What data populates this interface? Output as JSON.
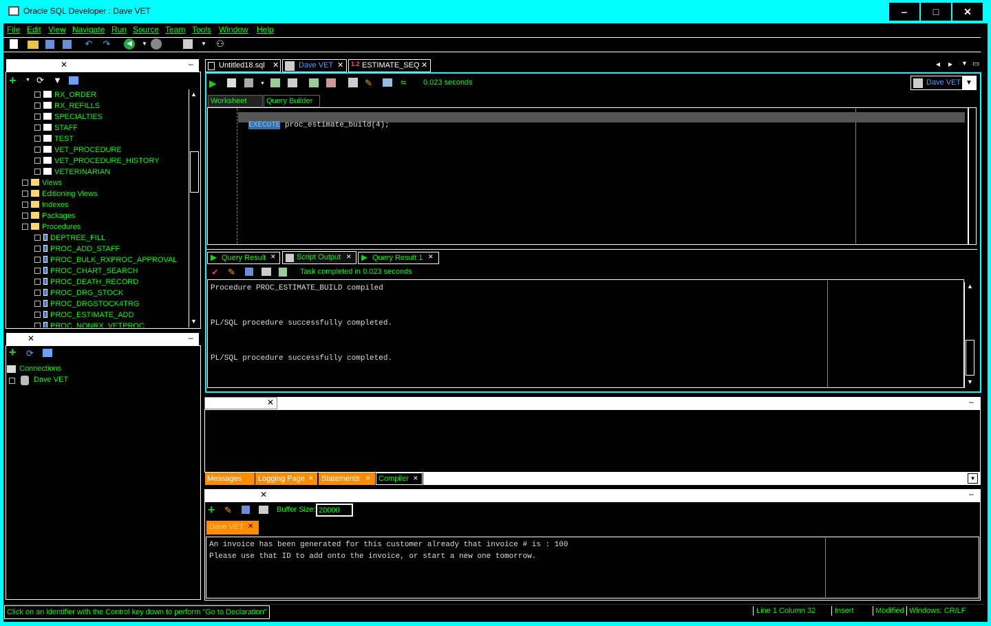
{
  "window": {
    "title": "Oracle SQL Developer : Dave VET",
    "min": "‒",
    "max": "□",
    "close": "✕"
  },
  "menu": [
    "File",
    "Edit",
    "View",
    "Navigate",
    "Run",
    "Source",
    "Team",
    "Tools",
    "Window",
    "Help"
  ],
  "editor_tabs": [
    {
      "label": "Untitled18.sql"
    },
    {
      "label": "Dave VET"
    },
    {
      "label": "ESTIMATE_SEQ"
    }
  ],
  "editor_toolbar": {
    "timing": "0.023 seconds",
    "connection": "Dave VET"
  },
  "subtabs": {
    "worksheet": "Worksheet",
    "query_builder": "Query Builder"
  },
  "code": {
    "keyword": "EXECUTE",
    "rest": " proc_estimate_build(4);"
  },
  "results_tabs": [
    "Query Result",
    "Script Output",
    "Query Result 1"
  ],
  "results_status": "Task completed in 0.023 seconds",
  "script_output": [
    "Procedure PROC_ESTIMATE_BUILD compiled",
    "",
    "",
    "PL/SQL procedure successfully completed.",
    "",
    "",
    "PL/SQL procedure successfully completed."
  ],
  "tree": [
    {
      "label": "RX_ORDER",
      "type": "table"
    },
    {
      "label": "RX_REFILLS",
      "type": "table"
    },
    {
      "label": "SPECIALTIES",
      "type": "table"
    },
    {
      "label": "STAFF",
      "type": "table"
    },
    {
      "label": "TEST",
      "type": "table"
    },
    {
      "label": "VET_PROCEDURE",
      "type": "table"
    },
    {
      "label": "VET_PROCEDURE_HISTORY",
      "type": "table"
    },
    {
      "label": "VETERINARIAN",
      "type": "table"
    },
    {
      "label": "Views",
      "type": "folder"
    },
    {
      "label": "Editioning Views",
      "type": "folder"
    },
    {
      "label": "Indexes",
      "type": "folder"
    },
    {
      "label": "Packages",
      "type": "folder"
    },
    {
      "label": "Procedures",
      "type": "folder"
    },
    {
      "label": "DEPTREE_FILL",
      "type": "proc"
    },
    {
      "label": "PROC_ADD_STAFF",
      "type": "proc"
    },
    {
      "label": "PROC_BULK_RXPROC_APPROVAL",
      "type": "proc"
    },
    {
      "label": "PROC_CHART_SEARCH",
      "type": "proc"
    },
    {
      "label": "PROC_DEATH_RECORD",
      "type": "proc"
    },
    {
      "label": "PROC_DRG_STOCK",
      "type": "proc"
    },
    {
      "label": "PROC_DRGSTOCK4TRG",
      "type": "proc"
    },
    {
      "label": "PROC_ESTIMATE_ADD",
      "type": "proc"
    },
    {
      "label": "PROC_NONRX_VETPROC",
      "type": "proc"
    }
  ],
  "connections": {
    "root": "Connections",
    "child": "Dave VET"
  },
  "log_tabs": [
    "Messages",
    "Logging Page",
    "Statements",
    "Compiler"
  ],
  "dbms": {
    "buffer_label": "Buffer Size:",
    "buffer_value": "20000",
    "conn_tab": "Dave VET",
    "lines": [
      "An invoice has been generated for this customer already that invoice # is : 100",
      "Please use that ID to add onto the invoice, or start a new one tomorrow."
    ]
  },
  "status": {
    "hint": "Click on an identifier with the Control key down to perform \"Go to Declaration\"",
    "position": "Line 1 Column 32",
    "mode": "Insert",
    "modified": "Modified",
    "eol": "Windows: CR/LF"
  },
  "colors": {
    "accent": "#00ffff",
    "text": "#00ff00",
    "tab_orange": "#ff8c00"
  }
}
